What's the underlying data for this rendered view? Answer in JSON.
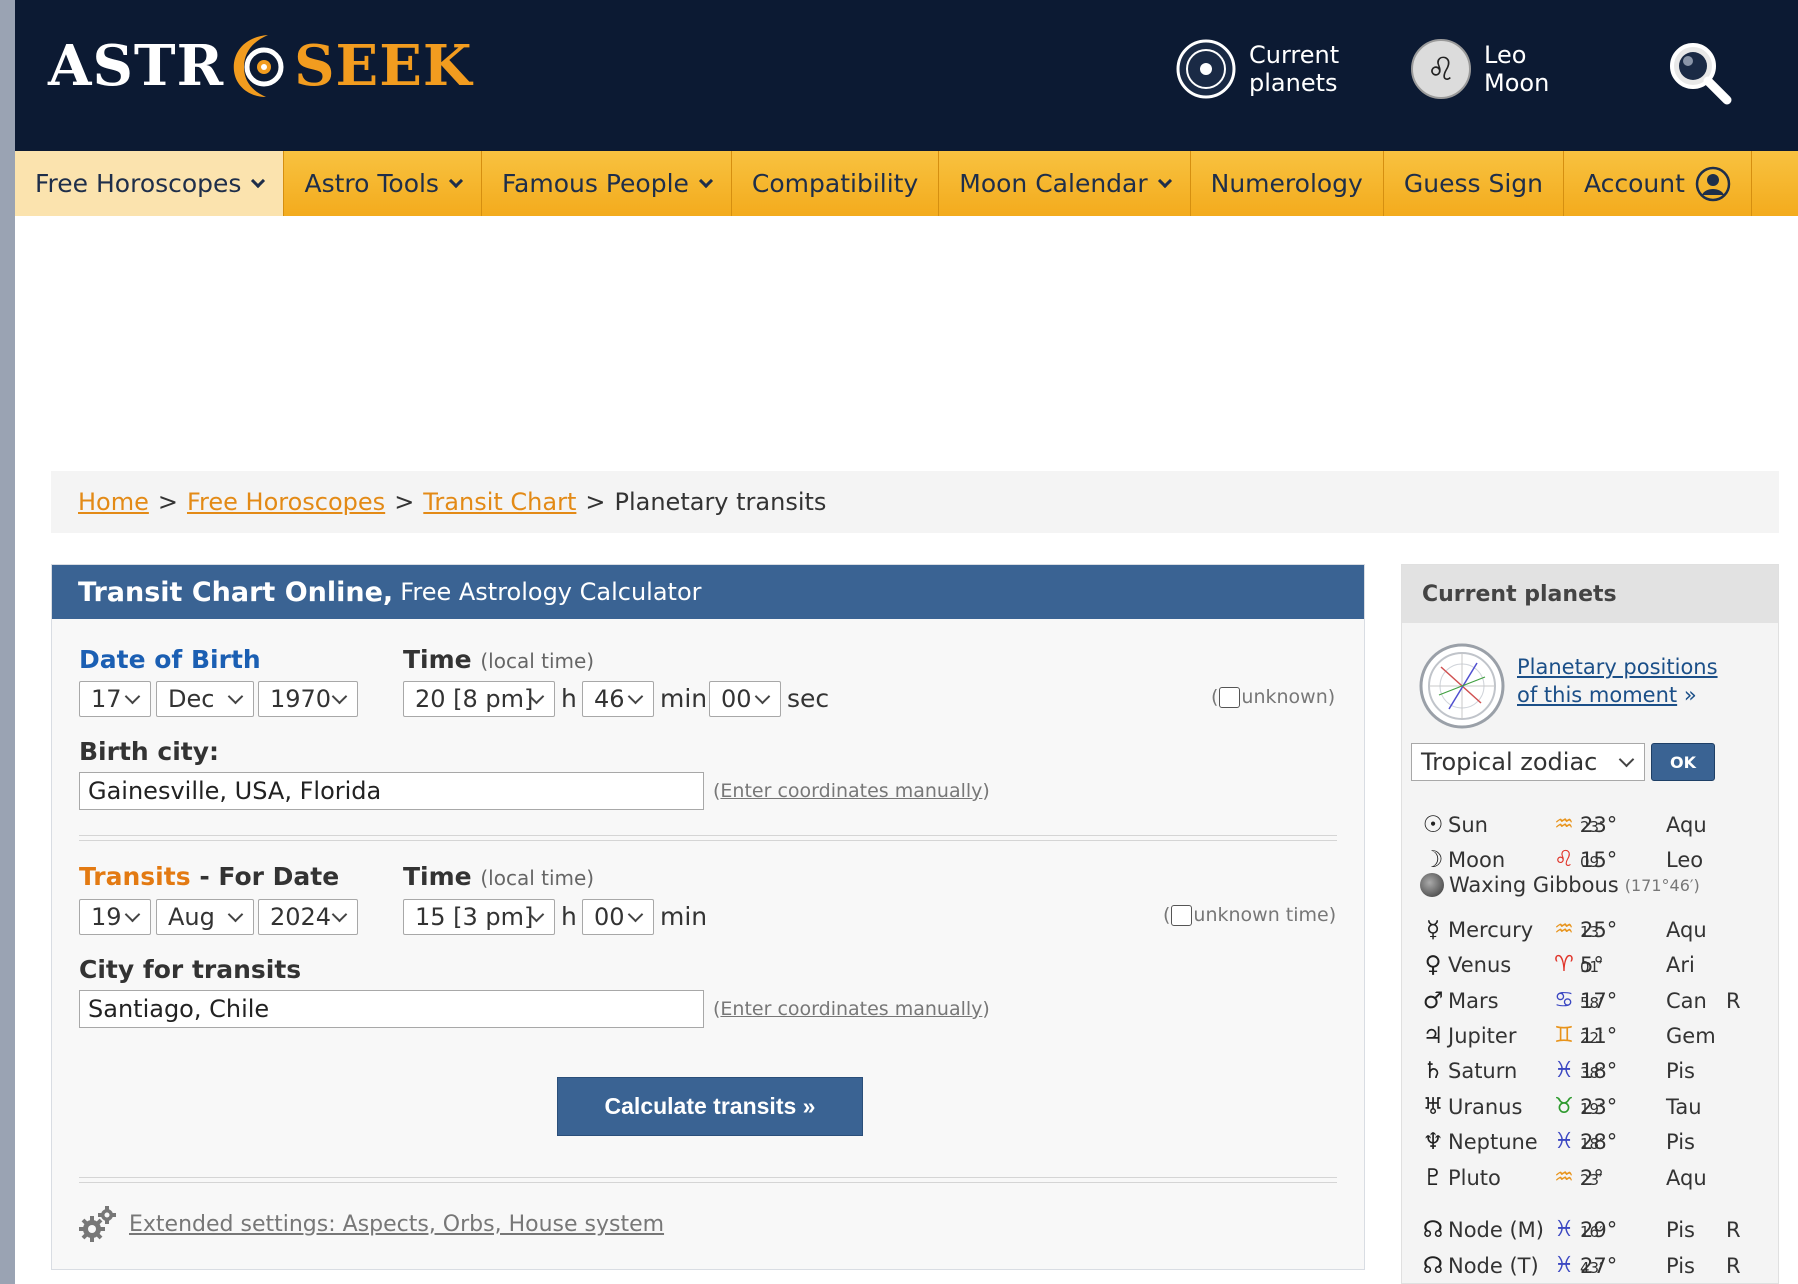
{
  "header": {
    "logo_left": "ASTR",
    "logo_right": "SEEK",
    "current_planets_line1": "Current",
    "current_planets_line2": "planets",
    "leo_moon_line1": "Leo",
    "leo_moon_line2": "Moon"
  },
  "nav": {
    "items": [
      {
        "label": "Free Horoscopes",
        "dropdown": true
      },
      {
        "label": "Astro Tools",
        "dropdown": true
      },
      {
        "label": "Famous People",
        "dropdown": true
      },
      {
        "label": "Compatibility",
        "dropdown": false
      },
      {
        "label": "Moon Calendar",
        "dropdown": true
      },
      {
        "label": "Numerology",
        "dropdown": false
      },
      {
        "label": "Guess Sign",
        "dropdown": false
      },
      {
        "label": "Account",
        "dropdown": false
      }
    ]
  },
  "breadcrumb": {
    "home": "Home",
    "free_horoscopes": "Free Horoscopes",
    "transit_chart": "Transit Chart",
    "current": "Planetary transits",
    "separator": ">"
  },
  "form": {
    "title_bold": "Transit Chart Online,",
    "title_rest": "Free Astrology Calculator",
    "birth": {
      "date_label": "Date of Birth",
      "time_label": "Time",
      "time_hint": "(local time)",
      "day": "17",
      "month": "Dec",
      "year": "1970",
      "hour": "20 [8 pm]",
      "minute": "46",
      "second": "00",
      "h_unit": "h",
      "min_unit": "min",
      "sec_unit": "sec",
      "unknown_label": "unknown",
      "city_label": "Birth city:",
      "city_value": "Gainesville, USA, Florida",
      "coords_link": "Enter coordinates manually"
    },
    "transits": {
      "label_orange": "Transits",
      "label_rest": "- For Date",
      "time_label": "Time",
      "time_hint": "(local time)",
      "day": "19",
      "month": "Aug",
      "year": "2024",
      "hour": "15 [3 pm]",
      "minute": "00",
      "h_unit": "h",
      "min_unit": "min",
      "unknown_label": "unknown time",
      "city_label": "City for transits",
      "city_value": "Santiago, Chile",
      "coords_link": "Enter coordinates manually"
    },
    "submit_label": "Calculate transits »",
    "extended_link": "Extended settings: Aspects, Orbs, House system"
  },
  "sidebar": {
    "title": "Current planets",
    "link_line1": "Planetary positions",
    "link_line2": "of this moment",
    "link_suffix": "»",
    "zodiac_select": "Tropical zodiac",
    "ok_label": "OK",
    "moon_phase": "Waxing Gibbous",
    "moon_phase_angle": "(171°46′)",
    "planets": [
      {
        "glyph": "☉",
        "name": "Sun",
        "sign_glyph": "♒",
        "sign_color": "#e8931a",
        "deg": "23°",
        "min": "23′",
        "sign": "Aqu",
        "retro": ""
      },
      {
        "glyph": "☽",
        "name": "Moon",
        "sign_glyph": "♌",
        "sign_color": "#e0352b",
        "deg": "15°",
        "min": "09′",
        "sign": "Leo",
        "retro": ""
      },
      {
        "glyph": "☿",
        "name": "Mercury",
        "sign_glyph": "♒",
        "sign_color": "#e8931a",
        "deg": "25°",
        "min": "13′",
        "sign": "Aqu",
        "retro": ""
      },
      {
        "glyph": "♀",
        "name": "Venus",
        "sign_glyph": "♈",
        "sign_color": "#e0352b",
        "deg": "5°",
        "min": "01′",
        "sign": "Ari",
        "retro": ""
      },
      {
        "glyph": "♂",
        "name": "Mars",
        "sign_glyph": "♋",
        "sign_color": "#3b47c2",
        "deg": "17°",
        "min": "58′",
        "sign": "Can",
        "retro": "R"
      },
      {
        "glyph": "♃",
        "name": "Jupiter",
        "sign_glyph": "♊",
        "sign_color": "#e8931a",
        "deg": "11°",
        "min": "22′",
        "sign": "Gem",
        "retro": ""
      },
      {
        "glyph": "♄",
        "name": "Saturn",
        "sign_glyph": "♓",
        "sign_color": "#3b47c2",
        "deg": "18°",
        "min": "38′",
        "sign": "Pis",
        "retro": ""
      },
      {
        "glyph": "♅",
        "name": "Uranus",
        "sign_glyph": "♉",
        "sign_color": "#2e9a2e",
        "deg": "23°",
        "min": "19′",
        "sign": "Tau",
        "retro": ""
      },
      {
        "glyph": "♆",
        "name": "Neptune",
        "sign_glyph": "♓",
        "sign_color": "#3b47c2",
        "deg": "28°",
        "min": "18′",
        "sign": "Pis",
        "retro": ""
      },
      {
        "glyph": "♇",
        "name": "Pluto",
        "sign_glyph": "♒",
        "sign_color": "#e8931a",
        "deg": "2°",
        "min": "23′",
        "sign": "Aqu",
        "retro": ""
      },
      {
        "glyph": "☊",
        "name": "Node (M)",
        "sign_glyph": "♓",
        "sign_color": "#3b47c2",
        "deg": "29°",
        "min": "16′",
        "sign": "Pis",
        "retro": "R"
      },
      {
        "glyph": "☊",
        "name": "Node (T)",
        "sign_glyph": "♓",
        "sign_color": "#3b47c2",
        "deg": "27°",
        "min": "43′",
        "sign": "Pis",
        "retro": "R"
      }
    ]
  },
  "colors": {
    "header_bg": "#0c1a33",
    "nav_bg": "#f3ab1d",
    "accent_blue": "#3a6393",
    "link_orange": "#e38a16"
  }
}
